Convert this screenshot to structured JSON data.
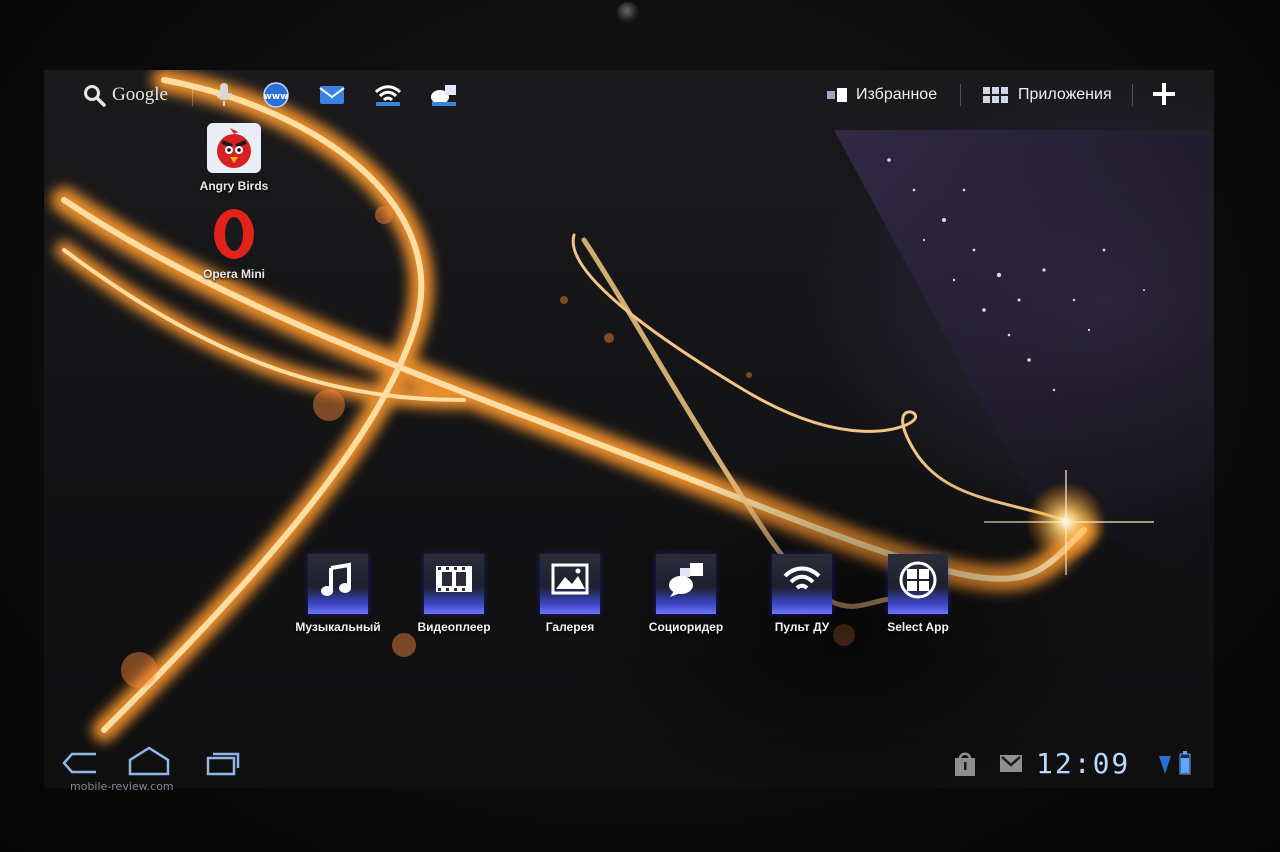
{
  "topbar": {
    "search_label": "Google",
    "favorites_label": "Избранное",
    "apps_label": "Приложения"
  },
  "desktop_shortcuts": [
    {
      "label": "Angry Birds",
      "icon": "angry-birds-icon"
    },
    {
      "label": "Opera Mini",
      "icon": "opera-mini-icon"
    }
  ],
  "dock": [
    {
      "label": "Музыкальный",
      "icon": "music-note-icon"
    },
    {
      "label": "Видеоплеер",
      "icon": "film-strip-icon"
    },
    {
      "label": "Галерея",
      "icon": "gallery-picture-icon"
    },
    {
      "label": "Социоридер",
      "icon": "speech-bubbles-icon"
    },
    {
      "label": "Пульт ДУ",
      "icon": "wifi-remote-icon"
    },
    {
      "label": "Select App",
      "icon": "select-app-icon"
    }
  ],
  "system_bar": {
    "clock": "12:09"
  },
  "watermark": "mobile-review.com",
  "colors": {
    "accent_blue": "#5a66ff",
    "light_streak": "#ffb347",
    "clock_text": "#b8d8ff"
  }
}
